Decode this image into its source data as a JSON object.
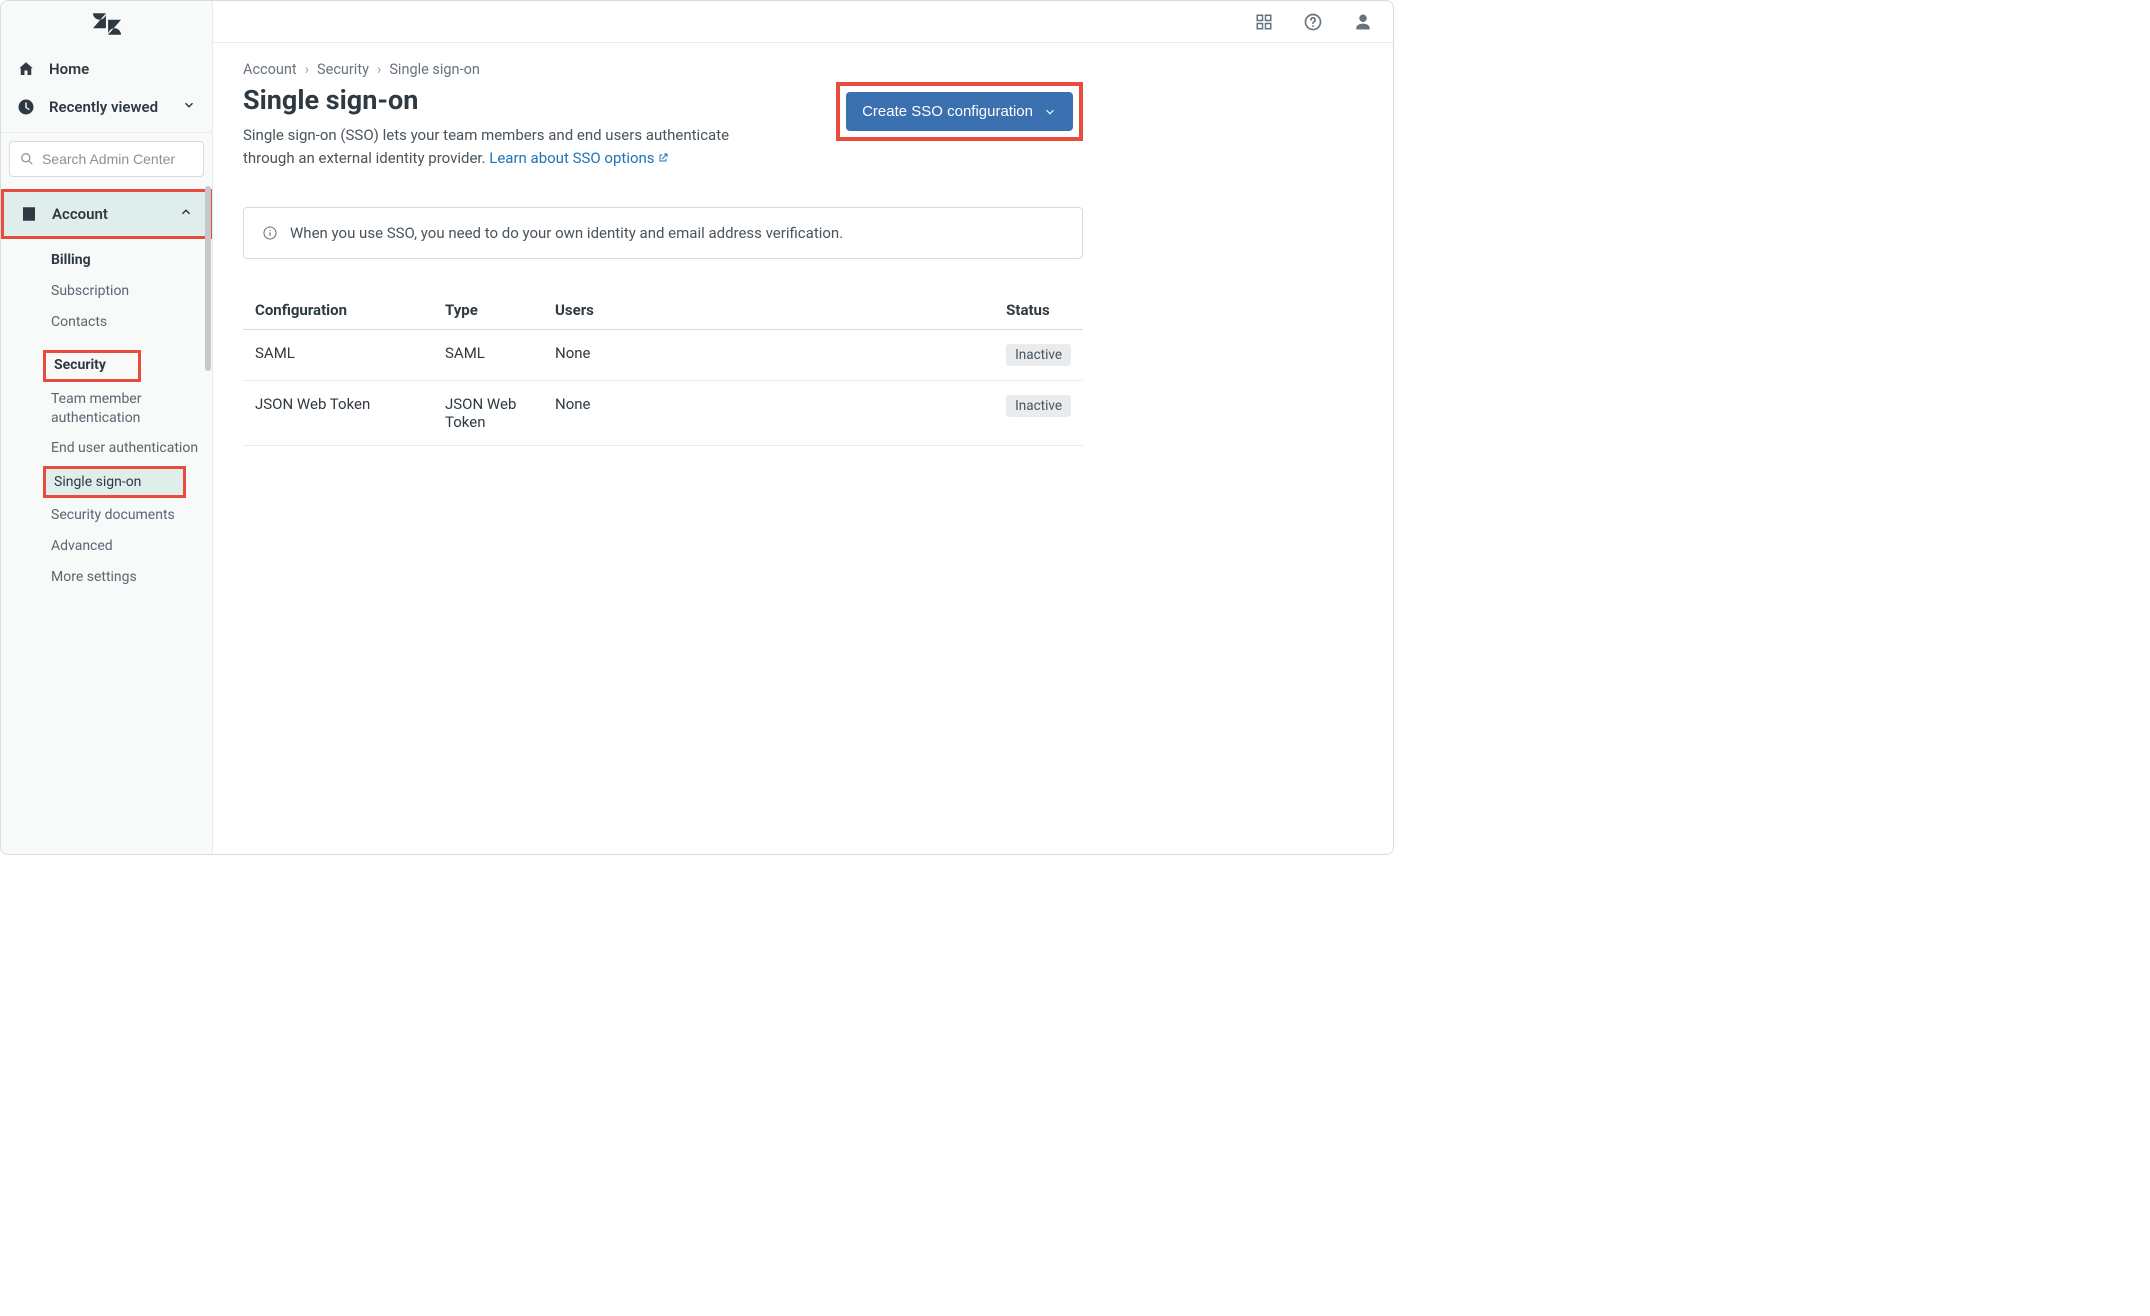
{
  "sidebar": {
    "home": "Home",
    "recent": "Recently viewed",
    "search_placeholder": "Search Admin Center",
    "category": "Account",
    "items": {
      "billing": "Billing",
      "subscription": "Subscription",
      "contacts": "Contacts",
      "security": "Security",
      "team_auth": "Team member authentication",
      "end_user_auth": "End user authentication",
      "sso": "Single sign-on",
      "sec_docs": "Security documents",
      "advanced": "Advanced",
      "more": "More settings"
    }
  },
  "breadcrumb": {
    "l1": "Account",
    "l2": "Security",
    "l3": "Single sign-on"
  },
  "page": {
    "title": "Single sign-on",
    "desc_pre": "Single sign-on (SSO) lets your team members and end users authenticate through an external identity provider. ",
    "desc_link": "Learn about SSO options",
    "cta": "Create SSO configuration",
    "banner": "When you use SSO, you need to do your own identity and email address verification."
  },
  "table": {
    "headers": {
      "config": "Configuration",
      "type": "Type",
      "users": "Users",
      "status": "Status"
    },
    "rows": [
      {
        "config": "SAML",
        "type": "SAML",
        "users": "None",
        "status": "Inactive"
      },
      {
        "config": "JSON Web Token",
        "type": "JSON Web Token",
        "users": "None",
        "status": "Inactive"
      }
    ]
  }
}
